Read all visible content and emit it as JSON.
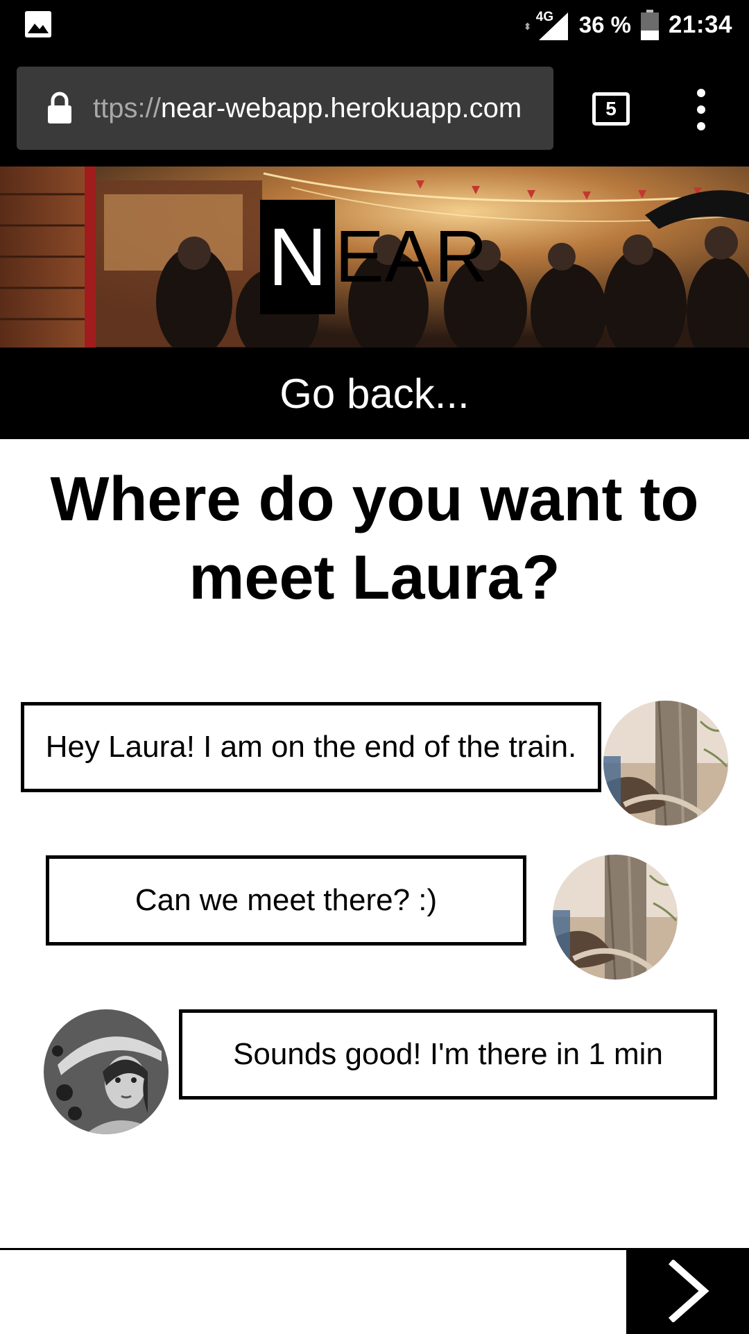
{
  "status_bar": {
    "gallery_icon": "image-icon",
    "network_type": "4G",
    "battery_level": 0.36,
    "battery_text": "36 %",
    "time": "21:34"
  },
  "browser": {
    "url_scheme": "ttps://",
    "url_host": "near-webapp.herokuapp.com",
    "tab_count": "5",
    "lock_icon": "lock-icon",
    "menu_icon": "more-vertical-icon"
  },
  "brand": {
    "logo_mark": "N",
    "logo_rest": "EAR"
  },
  "nav": {
    "go_back_label": "Go back..."
  },
  "title": "Where do you want to meet Laura?",
  "chat": {
    "messages": [
      {
        "text": "Hey Laura! I am on the end of the train.",
        "sender": "me",
        "avatar": "user-avatar"
      },
      {
        "text": "Can we meet there? :)",
        "sender": "me",
        "avatar": "user-avatar"
      },
      {
        "text": "Sounds good! I'm there in 1 min",
        "sender": "laura",
        "avatar": "laura-avatar"
      }
    ]
  },
  "composer": {
    "value": "",
    "placeholder": "",
    "send_icon": "chevron-right-icon"
  },
  "colors": {
    "bar_background": "#000000",
    "url_box": "#3a3a3a",
    "page_background": "#ffffff"
  }
}
